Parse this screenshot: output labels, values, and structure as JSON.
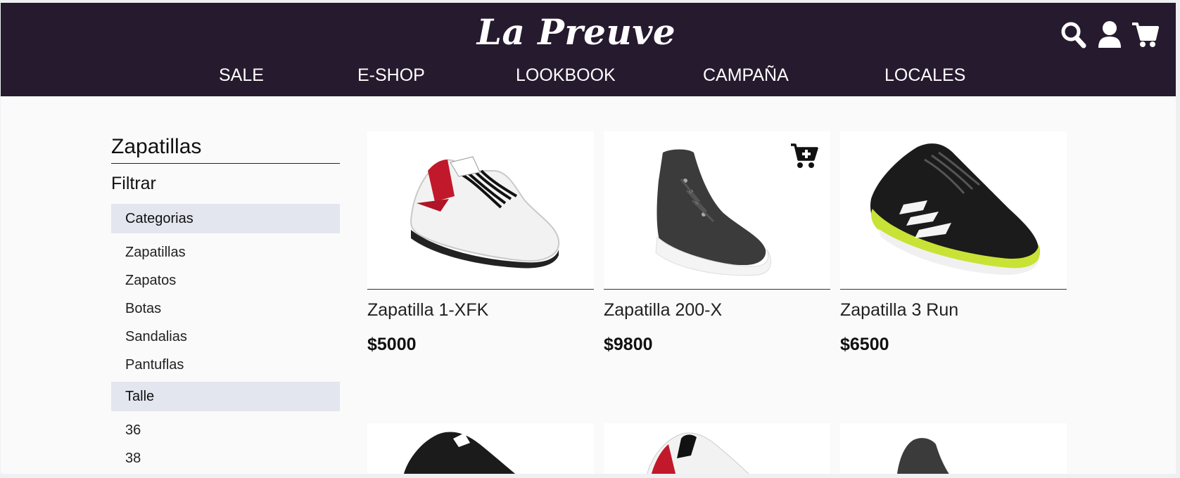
{
  "header": {
    "brand": "La Preuve",
    "nav": [
      "SALE",
      "E-SHOP",
      "LOOKBOOK",
      "CAMPAÑA",
      "LOCALES"
    ],
    "icons": [
      "search-icon",
      "user-icon",
      "cart-icon"
    ],
    "colors": {
      "header_bg": "#261a2e",
      "header_text": "#ffffff"
    }
  },
  "sidebar": {
    "title": "Zapatillas",
    "subtitle": "Filtrar",
    "categories_label": "Categorias",
    "categories": [
      "Zapatillas",
      "Zapatos",
      "Botas",
      "Sandalias",
      "Pantuflas"
    ],
    "size_label": "Talle",
    "sizes": [
      "36",
      "38"
    ],
    "colors": {
      "filter_head_bg": "#e3e6ee"
    }
  },
  "products": [
    {
      "name": "Zapatilla 1-XFK",
      "price": "$5000"
    },
    {
      "name": "Zapatilla 200-X",
      "price": "$9800"
    },
    {
      "name": "Zapatilla 3 Run",
      "price": "$6500"
    }
  ]
}
